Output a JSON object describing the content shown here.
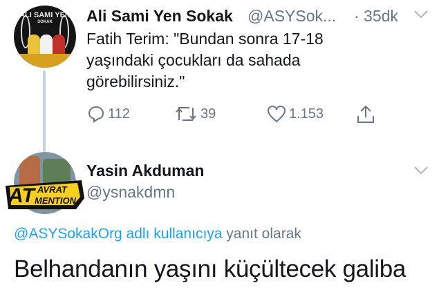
{
  "tweet1": {
    "avatar_text": "ALI SAMI YEN",
    "avatar_subtext": "SOKAK",
    "author_name": "Ali Sami Yen Sokak",
    "author_handle": "@ASYSok...",
    "time": "· 35dk",
    "text": "Fatih Terim: \"Bundan sonra 17-18\nyaşındaki çocukları da sahada\ngörebilirsiniz.\"",
    "replies": "112",
    "retweets": "39",
    "likes": "1.153",
    "icons": [
      "reply-icon",
      "retweet-icon",
      "like-icon",
      "share-icon",
      "chevron-down-icon"
    ]
  },
  "tweet2": {
    "author_name": "Yasin Akduman",
    "author_handle": "@ysnakdmn",
    "badge_text_top": "AVRAT",
    "badge_text_main": "AT",
    "badge_text_bottom": "MENTION",
    "reply_to": "@ASYSokakOrg adlı kullanıcıya",
    "reply_suffix": " yanıt olarak",
    "text": "Belhandanın yaşını küçültecek galiba"
  },
  "colors": {
    "text": "#14171a",
    "muted": "#657786",
    "link": "#1da1f2",
    "thread_line": "#c9d2d9"
  }
}
